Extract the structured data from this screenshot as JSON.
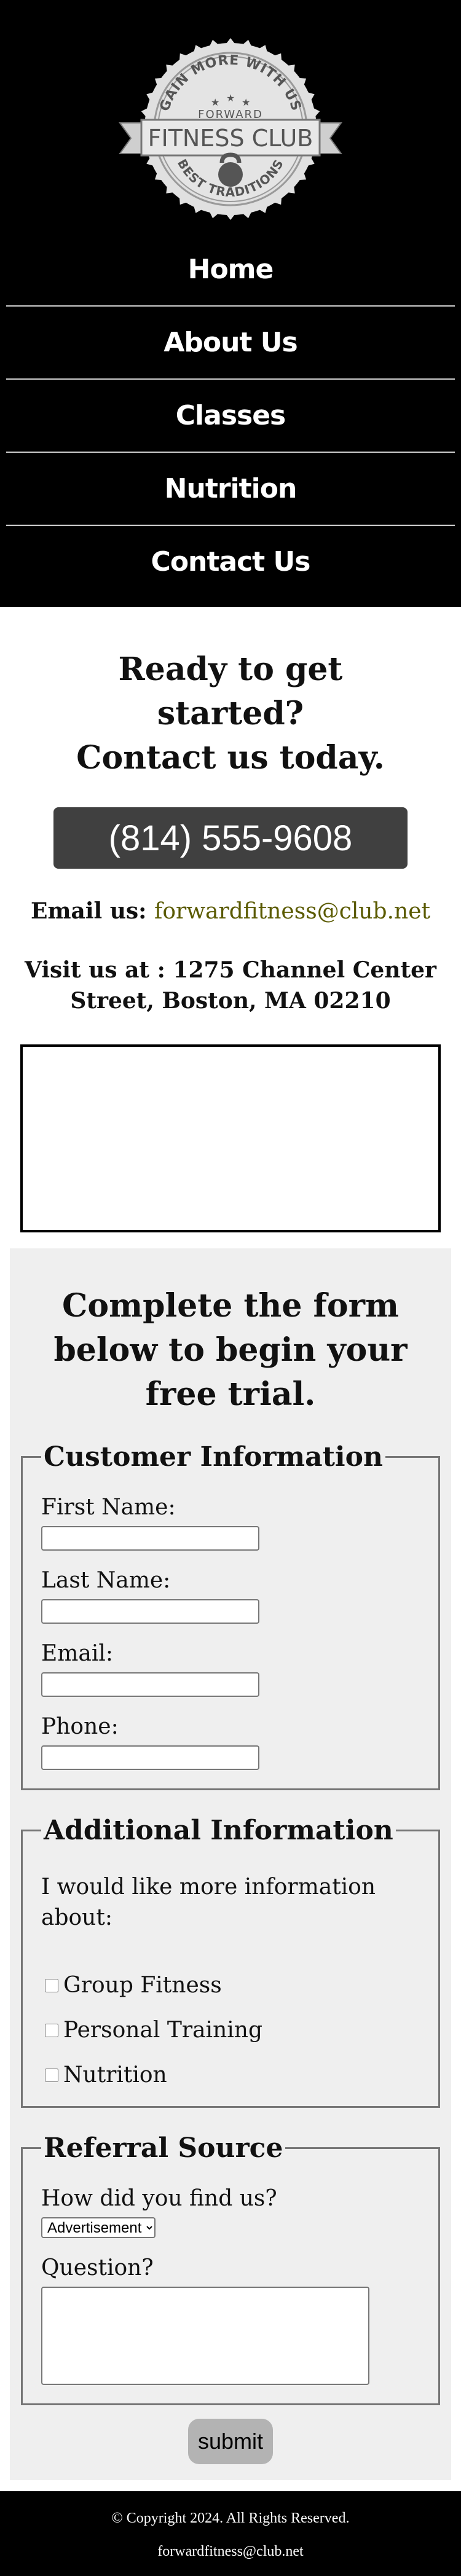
{
  "logo": {
    "arc_top": "GAIN MORE WITH US",
    "sub": "FORWARD",
    "name": "FITNESS CLUB",
    "arc_bottom": "BEST TRADITIONS",
    "icon": "kettlebell-icon"
  },
  "nav": {
    "items": [
      {
        "label": "Home"
      },
      {
        "label": "About Us"
      },
      {
        "label": "Classes"
      },
      {
        "label": "Nutrition"
      },
      {
        "label": "Contact Us"
      }
    ]
  },
  "contact": {
    "heading_line1": "Ready to get started?",
    "heading_line2": "Contact us today.",
    "phone": "(814) 555-9608",
    "email_label": "Email us:",
    "email": "forwardfitness@club.net",
    "visit": "Visit us at : 1275 Channel Center Street, Boston, MA 02210"
  },
  "form": {
    "heading": "Complete the form below to begin your free trial.",
    "customer": {
      "legend": "Customer Information",
      "first_name": "First Name:",
      "last_name": "Last Name:",
      "email": "Email:",
      "phone": "Phone:"
    },
    "additional": {
      "legend": "Additional Information",
      "prompt": "I would like more information about:",
      "options": [
        "Group Fitness",
        "Personal Training",
        "Nutrition"
      ]
    },
    "referral": {
      "legend": "Referral Source",
      "question": "How did you find us?",
      "selected": "Advertisement",
      "question_label": "Question?"
    },
    "submit_label": "submit"
  },
  "footer": {
    "copyright": "© Copyright 2024. All Rights Reserved.",
    "email": "forwardfitness@club.net"
  },
  "colors": {
    "header_bg": "#000000",
    "phone_button": "#404040",
    "email_link": "#5a5a00",
    "form_bg": "#efefef",
    "submit_button": "#b3b3b3"
  }
}
